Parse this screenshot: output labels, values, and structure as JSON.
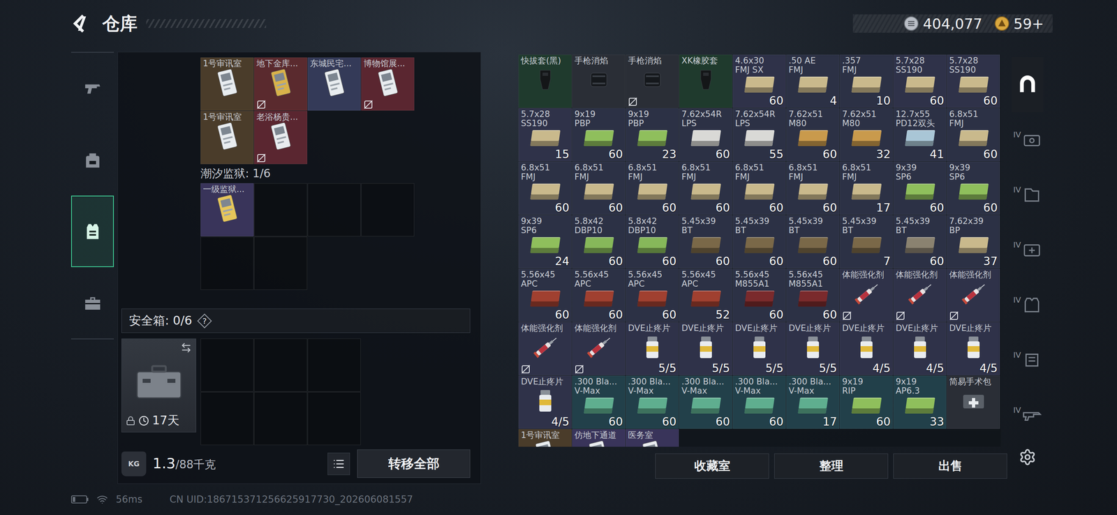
{
  "header": {
    "title": "仓库",
    "currency": [
      {
        "kind": "silver",
        "value": "404,077"
      },
      {
        "kind": "gold",
        "value": "59+"
      }
    ]
  },
  "nav": [
    {
      "kind": "pistol",
      "selected": false
    },
    {
      "kind": "backpack",
      "selected": false
    },
    {
      "kind": "vest",
      "selected": true
    },
    {
      "kind": "toolbox",
      "selected": false
    }
  ],
  "key_groups": [
    {
      "cards": [
        {
          "name": [
            "1号审讯室"
          ],
          "kind": "key",
          "color": "#4a3c2a",
          "accent": "#e8ecef",
          "no_trade": false
        },
        {
          "name": [
            "地下金库..."
          ],
          "kind": "key",
          "color": "#5a2a2e",
          "accent": "#d9b24a",
          "no_trade": true
        },
        {
          "name": [
            "东城民宅..."
          ],
          "kind": "key",
          "color": "#343a58",
          "accent": "#e8ecef",
          "no_trade": false
        },
        {
          "name": [
            "博物馆展..."
          ],
          "kind": "key",
          "color": "#5a2630",
          "accent": "#e8ecef",
          "no_trade": true
        },
        {
          "name": [
            "1号审讯室"
          ],
          "kind": "key",
          "color": "#4a3c2a",
          "accent": "#e8ecef",
          "no_trade": false
        },
        {
          "name": [
            "老浴杨贵..."
          ],
          "kind": "key",
          "color": "#5a2630",
          "accent": "#e8ecef",
          "no_trade": true
        }
      ]
    },
    {
      "label": "潮汐监狱: 1/6",
      "slots": 6,
      "cards": [
        {
          "name": [
            "一级监狱..."
          ],
          "kind": "key",
          "color": "#39345a",
          "accent": "#e6c65a",
          "no_trade": false
        }
      ]
    }
  ],
  "safe_box": {
    "label": "安全箱: 0/6",
    "help": "?",
    "days": "17天",
    "locked": true,
    "slots": 6
  },
  "weight": {
    "badge": "KG",
    "value": "1.3",
    "max": "/88千克"
  },
  "transfer_button": "转移全部",
  "items": [
    {
      "name": [
        "快拔套(黑)"
      ],
      "kind": "holster",
      "color": "#1f3a2d",
      "no_trade": false
    },
    {
      "name": [
        "手枪消焰"
      ],
      "kind": "muzzle",
      "color": "#2a2e36",
      "no_trade": false
    },
    {
      "name": [
        "手枪消焰"
      ],
      "kind": "muzzle",
      "color": "#2a2e36",
      "no_trade": true
    },
    {
      "name": [
        "XK橡胶套"
      ],
      "kind": "grip",
      "color": "#1f3a2d",
      "no_trade": false
    },
    {
      "name": [
        "4.6x30",
        "FMJ SX"
      ],
      "kind": "ammo",
      "color": "#2f3249",
      "accent": "#c9b98c",
      "count": "60",
      "no_trade": false
    },
    {
      "name": [
        ".50 AE",
        "FMJ"
      ],
      "kind": "ammo",
      "color": "#2c3145",
      "accent": "#c9b98c",
      "count": "4",
      "no_trade": false
    },
    {
      "name": [
        ".357",
        "FMJ"
      ],
      "kind": "ammo",
      "color": "#2c3145",
      "accent": "#c9b98c",
      "count": "10",
      "no_trade": false
    },
    {
      "name": [
        "5.7x28",
        "SS190"
      ],
      "kind": "ammo",
      "color": "#2f3249",
      "accent": "#c9b98c",
      "count": "60",
      "no_trade": false
    },
    {
      "name": [
        "5.7x28",
        "SS190"
      ],
      "kind": "ammo",
      "color": "#2f3249",
      "accent": "#c9b98c",
      "count": "60",
      "no_trade": false
    },
    {
      "name": [
        "5.7x28",
        "SS190"
      ],
      "kind": "ammo",
      "color": "#2f3249",
      "accent": "#c9b98c",
      "count": "15",
      "no_trade": false
    },
    {
      "name": [
        "9x19",
        "PBP"
      ],
      "kind": "ammo",
      "color": "#2c3145",
      "accent": "#8fbf5c",
      "count": "60",
      "no_trade": false
    },
    {
      "name": [
        "9x19",
        "PBP"
      ],
      "kind": "ammo",
      "color": "#2c3145",
      "accent": "#8fbf5c",
      "count": "23",
      "no_trade": false
    },
    {
      "name": [
        "7.62x54R",
        "LPS"
      ],
      "kind": "ammo",
      "color": "#2c3145",
      "accent": "#d9d9d6",
      "count": "60",
      "no_trade": false
    },
    {
      "name": [
        "7.62x54R",
        "LPS"
      ],
      "kind": "ammo",
      "color": "#2c3145",
      "accent": "#d9d9d6",
      "count": "55",
      "no_trade": false
    },
    {
      "name": [
        "7.62x51",
        "M80"
      ],
      "kind": "ammo",
      "color": "#2c3145",
      "accent": "#c99a4c",
      "count": "60",
      "no_trade": false
    },
    {
      "name": [
        "7.62x51",
        "M80"
      ],
      "kind": "ammo",
      "color": "#2c3145",
      "accent": "#c99a4c",
      "count": "32",
      "no_trade": false
    },
    {
      "name": [
        "12.7x55",
        "PD12双头"
      ],
      "kind": "ammo",
      "color": "#2c3145",
      "accent": "#a9c6d6",
      "count": "41",
      "no_trade": false
    },
    {
      "name": [
        "6.8x51",
        "FMJ"
      ],
      "kind": "ammo",
      "color": "#2c3145",
      "accent": "#c9b98c",
      "count": "60",
      "no_trade": false
    },
    {
      "name": [
        "6.8x51",
        "FMJ"
      ],
      "kind": "ammo",
      "color": "#2c3145",
      "accent": "#c9b98c",
      "count": "60",
      "no_trade": false
    },
    {
      "name": [
        "6.8x51",
        "FMJ"
      ],
      "kind": "ammo",
      "color": "#2c3145",
      "accent": "#c9b98c",
      "count": "60",
      "no_trade": false
    },
    {
      "name": [
        "6.8x51",
        "FMJ"
      ],
      "kind": "ammo",
      "color": "#2c3145",
      "accent": "#c9b98c",
      "count": "60",
      "no_trade": false
    },
    {
      "name": [
        "6.8x51",
        "FMJ"
      ],
      "kind": "ammo",
      "color": "#2c3145",
      "accent": "#c9b98c",
      "count": "60",
      "no_trade": false
    },
    {
      "name": [
        "6.8x51",
        "FMJ"
      ],
      "kind": "ammo",
      "color": "#2c3145",
      "accent": "#c9b98c",
      "count": "60",
      "no_trade": false
    },
    {
      "name": [
        "6.8x51",
        "FMJ"
      ],
      "kind": "ammo",
      "color": "#2c3145",
      "accent": "#c9b98c",
      "count": "60",
      "no_trade": false
    },
    {
      "name": [
        "6.8x51",
        "FMJ"
      ],
      "kind": "ammo",
      "color": "#2c3145",
      "accent": "#c9b98c",
      "count": "17",
      "no_trade": false
    },
    {
      "name": [
        "9x39",
        "SP6"
      ],
      "kind": "ammo",
      "color": "#2c3145",
      "accent": "#8fbf5c",
      "count": "60",
      "no_trade": false
    },
    {
      "name": [
        "9x39",
        "SP6"
      ],
      "kind": "ammo",
      "color": "#2c3145",
      "accent": "#8fbf5c",
      "count": "60",
      "no_trade": false
    },
    {
      "name": [
        "9x39",
        "SP6"
      ],
      "kind": "ammo",
      "color": "#2c3145",
      "accent": "#8fbf5c",
      "count": "24",
      "no_trade": false
    },
    {
      "name": [
        "5.8x42",
        "DBP10"
      ],
      "kind": "ammo",
      "color": "#2c3145",
      "accent": "#86b85a",
      "count": "60",
      "no_trade": false
    },
    {
      "name": [
        "5.8x42",
        "DBP10"
      ],
      "kind": "ammo",
      "color": "#2c3145",
      "accent": "#86b85a",
      "count": "60",
      "no_trade": false
    },
    {
      "name": [
        "5.45x39",
        "BT"
      ],
      "kind": "ammo",
      "color": "#2c3145",
      "accent": "#7a6848",
      "count": "60",
      "no_trade": false
    },
    {
      "name": [
        "5.45x39",
        "BT"
      ],
      "kind": "ammo",
      "color": "#2c3145",
      "accent": "#7a6848",
      "count": "60",
      "no_trade": false
    },
    {
      "name": [
        "5.45x39",
        "BT"
      ],
      "kind": "ammo",
      "color": "#2c3145",
      "accent": "#7a6848",
      "count": "60",
      "no_trade": false
    },
    {
      "name": [
        "5.45x39",
        "BT"
      ],
      "kind": "ammo",
      "color": "#2c3145",
      "accent": "#7a6848",
      "count": "7",
      "no_trade": false
    },
    {
      "name": [
        "5.45x39",
        "BT"
      ],
      "kind": "ammo",
      "color": "#2c3145",
      "accent": "#8a8270",
      "count": "60",
      "no_trade": false
    },
    {
      "name": [
        "7.62x39",
        "BP"
      ],
      "kind": "ammo",
      "color": "#2c3145",
      "accent": "#c9b98c",
      "count": "37",
      "no_trade": false
    },
    {
      "name": [
        "5.56x45",
        "APC"
      ],
      "kind": "ammo",
      "color": "#2c3145",
      "accent": "#a04030",
      "count": "60",
      "no_trade": false
    },
    {
      "name": [
        "5.56x45",
        "APC"
      ],
      "kind": "ammo",
      "color": "#2c3145",
      "accent": "#a04030",
      "count": "60",
      "no_trade": false
    },
    {
      "name": [
        "5.56x45",
        "APC"
      ],
      "kind": "ammo",
      "color": "#2c3145",
      "accent": "#a04030",
      "count": "60",
      "no_trade": false
    },
    {
      "name": [
        "5.56x45",
        "APC"
      ],
      "kind": "ammo",
      "color": "#2c3145",
      "accent": "#a04030",
      "count": "52",
      "no_trade": false
    },
    {
      "name": [
        "5.56x45",
        "M855A1"
      ],
      "kind": "ammo",
      "color": "#2c3145",
      "accent": "#7a2a2c",
      "count": "60",
      "no_trade": false
    },
    {
      "name": [
        "5.56x45",
        "M855A1"
      ],
      "kind": "ammo",
      "color": "#2c3145",
      "accent": "#7a2a2c",
      "count": "60",
      "no_trade": false
    },
    {
      "name": [
        "体能强化剂"
      ],
      "kind": "stim",
      "color": "#2f3249",
      "no_trade": true
    },
    {
      "name": [
        "体能强化剂"
      ],
      "kind": "stim",
      "color": "#2f3249",
      "no_trade": true
    },
    {
      "name": [
        "体能强化剂"
      ],
      "kind": "stim",
      "color": "#2f3249",
      "no_trade": true
    },
    {
      "name": [
        "体能强化剂"
      ],
      "kind": "stim",
      "color": "#2f3249",
      "no_trade": true
    },
    {
      "name": [
        "体能强化剂"
      ],
      "kind": "stim",
      "color": "#2f3249",
      "no_trade": true
    },
    {
      "name": [
        "DVE止疼片"
      ],
      "kind": "pill",
      "color": "#2f3249",
      "count": "5/5",
      "no_trade": false
    },
    {
      "name": [
        "DVE止疼片"
      ],
      "kind": "pill",
      "color": "#2f3249",
      "count": "5/5",
      "no_trade": false
    },
    {
      "name": [
        "DVE止疼片"
      ],
      "kind": "pill",
      "color": "#2f3249",
      "count": "5/5",
      "no_trade": false
    },
    {
      "name": [
        "DVE止疼片"
      ],
      "kind": "pill",
      "color": "#2f3249",
      "count": "5/5",
      "no_trade": false
    },
    {
      "name": [
        "DVE止疼片"
      ],
      "kind": "pill",
      "color": "#2f3249",
      "count": "4/5",
      "no_trade": false
    },
    {
      "name": [
        "DVE止疼片"
      ],
      "kind": "pill",
      "color": "#2f3249",
      "count": "4/5",
      "no_trade": false
    },
    {
      "name": [
        "DVE止疼片"
      ],
      "kind": "pill",
      "color": "#2f3249",
      "count": "4/5",
      "no_trade": false
    },
    {
      "name": [
        "DVE止疼片"
      ],
      "kind": "pill",
      "color": "#2f3249",
      "count": "4/5",
      "no_trade": false
    },
    {
      "name": [
        ".300 Bla...",
        "V-Max"
      ],
      "kind": "ammo",
      "color": "#22404a",
      "accent": "#5fae8f",
      "count": "60",
      "no_trade": false
    },
    {
      "name": [
        ".300 Bla...",
        "V-Max"
      ],
      "kind": "ammo",
      "color": "#22404a",
      "accent": "#5fae8f",
      "count": "60",
      "no_trade": false
    },
    {
      "name": [
        ".300 Bla...",
        "V-Max"
      ],
      "kind": "ammo",
      "color": "#22404a",
      "accent": "#5fae8f",
      "count": "60",
      "no_trade": false
    },
    {
      "name": [
        ".300 Bla...",
        "V-Max"
      ],
      "kind": "ammo",
      "color": "#22404a",
      "accent": "#5fae8f",
      "count": "60",
      "no_trade": false
    },
    {
      "name": [
        ".300 Bla...",
        "V-Max"
      ],
      "kind": "ammo",
      "color": "#22404a",
      "accent": "#5fae8f",
      "count": "17",
      "no_trade": false
    },
    {
      "name": [
        "9x19",
        "RIP"
      ],
      "kind": "ammo",
      "color": "#22404a",
      "accent": "#8fbf5c",
      "count": "60",
      "no_trade": false
    },
    {
      "name": [
        "9x19",
        "AP6.3"
      ],
      "kind": "ammo",
      "color": "#22404a",
      "accent": "#8fbf5c",
      "count": "33",
      "no_trade": false
    },
    {
      "name": [
        "简易手术包"
      ],
      "kind": "medkit",
      "color": "#2a2e36",
      "no_trade": false
    },
    {
      "name": [
        "1号审讯室"
      ],
      "kind": "key",
      "color": "#4a3c2a",
      "accent": "#e8ecef",
      "no_trade": false
    },
    {
      "name": [
        "仿地下通道"
      ],
      "kind": "key",
      "color": "#39345a",
      "accent": "#e8ecef",
      "no_trade": false
    },
    {
      "name": [
        "医务室"
      ],
      "kind": "key",
      "color": "#39345a",
      "accent": "#e8ecef",
      "no_trade": false
    }
  ],
  "actions": [
    "收藏室",
    "整理",
    "出售"
  ],
  "side_tabs": [
    {
      "kind": "safe",
      "badge": "",
      "selected": true
    },
    {
      "kind": "case",
      "badge": "IV",
      "selected": false
    },
    {
      "kind": "folder",
      "badge": "IV",
      "selected": false
    },
    {
      "kind": "medical",
      "badge": "IV",
      "selected": false
    },
    {
      "kind": "armor",
      "badge": "IV",
      "selected": false
    },
    {
      "kind": "rig",
      "badge": "IV",
      "selected": false
    },
    {
      "kind": "gun",
      "badge": "IV",
      "selected": false
    }
  ],
  "footer": {
    "battery": {
      "level": 0.2
    },
    "ping": "56ms",
    "uid": "CN UID:186715371256625917730_202606081557"
  }
}
